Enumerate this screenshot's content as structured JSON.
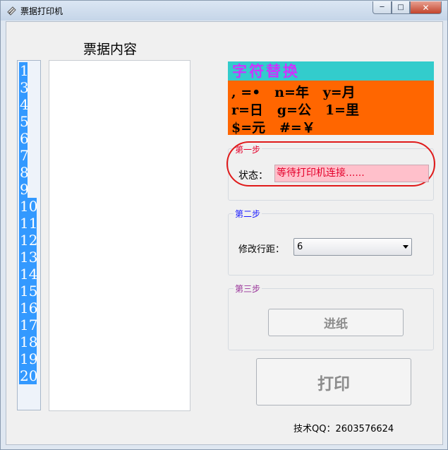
{
  "window": {
    "title": "票据打印机",
    "min_glyph": "─",
    "max_glyph": "□",
    "close_glyph": "✕"
  },
  "panel": {
    "heading": "票据内容",
    "line_numbers": [
      "1",
      "3",
      "4",
      "5",
      "6",
      "7",
      "8",
      "9",
      "10",
      "11",
      "12",
      "13",
      "14",
      "15",
      "16",
      "17",
      "18",
      "19",
      "20"
    ],
    "content": ""
  },
  "legend": {
    "title": "字符替换",
    "rows": [
      ", =•   n=年   y=月",
      "r=日   g=公   1=里",
      "$=元   #=￥"
    ]
  },
  "step1": {
    "title": "第一步",
    "status_label": "状态：",
    "status_value": "等待打印机连接......"
  },
  "step2": {
    "title": "第二步",
    "spacing_label": "修改行距：",
    "spacing_value": "6"
  },
  "step3": {
    "title": "第三步",
    "feed_button": "进纸"
  },
  "print_button": "打印",
  "footer": {
    "qq": "技术QQ：2603576624"
  },
  "colors": {
    "selection": "#3399ff",
    "legend_header_bg": "#33cccc",
    "legend_header_text": "#cc33ff",
    "legend_body_bg": "#ff6600",
    "status_bg": "#ffc0cb",
    "status_text": "#e4002b",
    "step1_title": "#e4002b",
    "step2_title": "#1a1aff",
    "step3_title": "#993399",
    "annotation_ring": "#e01a1a"
  }
}
